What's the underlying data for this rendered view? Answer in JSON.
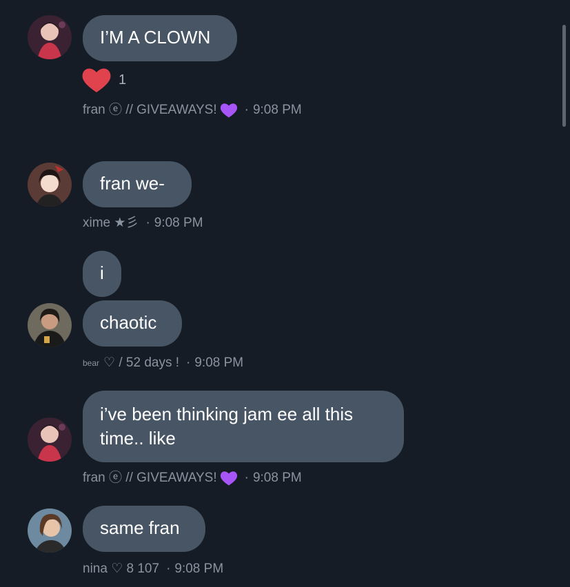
{
  "messages": [
    {
      "text": "I’M A CLOWN",
      "reaction": {
        "icon": "heart-icon",
        "count": "1"
      },
      "meta": {
        "name": "fran ⓔ // GIVEAWAYS!",
        "emoji": "purple-heart-icon",
        "time": "9:08 PM"
      }
    },
    {
      "text": "fran we-",
      "meta": {
        "name": "xime ★彡",
        "time": "9:08 PM"
      }
    },
    {
      "texts": [
        "i",
        "chaotic"
      ],
      "meta": {
        "name_small": "bear",
        "name": "♡ / 52 days !",
        "time": "9:08 PM"
      }
    },
    {
      "text": "i’ve been thinking jam ee all this time.. like",
      "meta": {
        "name": "fran ⓔ // GIVEAWAYS!",
        "emoji": "purple-heart-icon",
        "time": "9:08 PM"
      }
    },
    {
      "text": "same fran",
      "meta": {
        "name": "nina ♡ 8 107",
        "time": "9:08 PM"
      }
    }
  ],
  "separator": "·",
  "colors": {
    "background": "#161c25",
    "bubble": "#475565",
    "meta_text": "#8a93a0",
    "heart": "#e0434e",
    "purple_heart": "#a855f7"
  }
}
